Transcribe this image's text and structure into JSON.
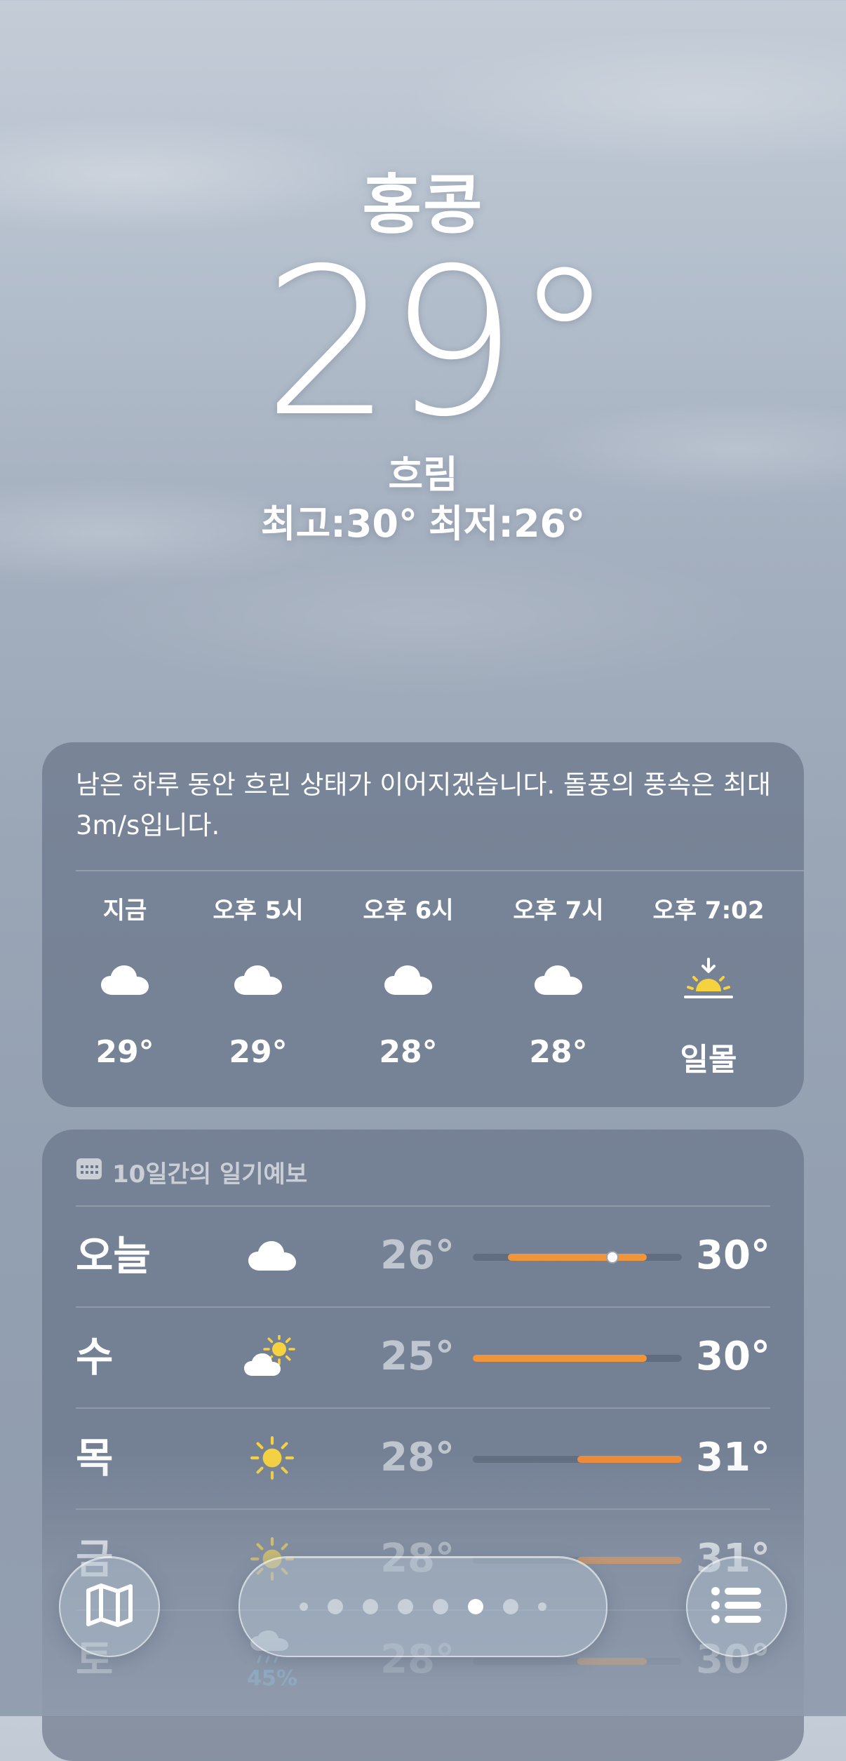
{
  "location": {
    "city": "홍콩",
    "temperature": "29°",
    "condition": "흐림",
    "high": "최고:30°",
    "low": "최저:26°"
  },
  "hourly": {
    "summary": "남은 하루 동안 흐린 상태가 이어지겠습니다. 돌풍의 풍속은 최대 3m/s입니다.",
    "items": [
      {
        "time": "지금",
        "icon": "cloud-icon",
        "temp": "29°"
      },
      {
        "time": "오후 5시",
        "icon": "cloud-icon",
        "temp": "29°"
      },
      {
        "time": "오후 6시",
        "icon": "cloud-icon",
        "temp": "28°"
      },
      {
        "time": "오후 7시",
        "icon": "cloud-icon",
        "temp": "28°"
      },
      {
        "time": "오후 7:02",
        "icon": "sunset-icon",
        "temp": "일몰"
      }
    ]
  },
  "daily": {
    "title": "10일간의 일기예보",
    "range_min": 25,
    "range_max": 31,
    "days": [
      {
        "day": "오늘",
        "icon": "cloud-icon",
        "low": "26°",
        "high": "30°",
        "low_value": 26,
        "high_value": 30,
        "current_value": 29,
        "precip": ""
      },
      {
        "day": "수",
        "icon": "partly-sunny-icon",
        "low": "25°",
        "high": "30°",
        "low_value": 25,
        "high_value": 30,
        "precip": ""
      },
      {
        "day": "목",
        "icon": "sun-icon",
        "low": "28°",
        "high": "31°",
        "low_value": 28,
        "high_value": 31,
        "precip": ""
      },
      {
        "day": "금",
        "icon": "sun-icon",
        "low": "28°",
        "high": "31°",
        "low_value": 28,
        "high_value": 31,
        "precip": ""
      },
      {
        "day": "토",
        "icon": "rain-cloud-icon",
        "low": "28°",
        "high": "30°",
        "low_value": 28,
        "high_value": 30,
        "precip": "45%"
      }
    ]
  },
  "pager": {
    "page_count": 8,
    "active_index": 5
  },
  "colors": {
    "bar_fill": "#f0953a",
    "bar_fill_warm": "#f08a34",
    "sun": "#f7d23f",
    "precip": "#7fc4ef"
  }
}
